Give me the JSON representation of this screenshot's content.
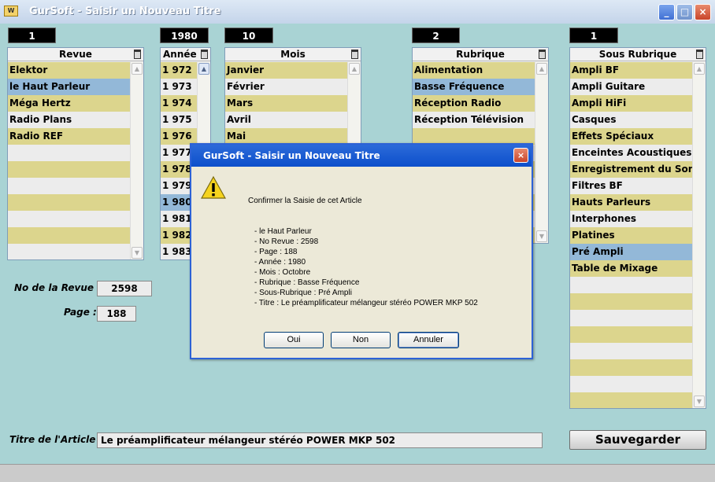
{
  "window": {
    "logo_text": "W",
    "title": "GurSoft   -   Saisir un Nouveau Titre"
  },
  "counters": {
    "revue": "1",
    "annee": "1980",
    "mois": "10",
    "rubrique": "2",
    "sous_rubrique": "1"
  },
  "lists": {
    "revue": {
      "header": "Revue",
      "items": [
        "Elektor",
        "le Haut Parleur",
        "Méga Hertz",
        "Radio Plans",
        "Radio REF"
      ],
      "selected": 1,
      "rows": 12
    },
    "annee": {
      "header": "Année",
      "items": [
        "1 972",
        "1 973",
        "1 974",
        "1 975",
        "1 976",
        "1 977",
        "1 978",
        "1 979",
        "1 980",
        "1 981",
        "1 982",
        "1 983"
      ],
      "selected": 8,
      "rows": 12
    },
    "mois": {
      "header": "Mois",
      "items": [
        "Janvier",
        "Février",
        "Mars",
        "Avril",
        "Mai"
      ],
      "selected": -1,
      "rows": 12
    },
    "rubrique": {
      "header": "Rubrique",
      "items": [
        "Alimentation",
        "Basse Fréquence",
        "Réception Radio",
        "Réception Télévision"
      ],
      "selected": 1,
      "rows": 12
    },
    "sous_rubrique": {
      "header": "Sous Rubrique",
      "items": [
        "Ampli BF",
        "Ampli Guitare",
        "Ampli HiFi",
        "Casques",
        "Effets Spéciaux",
        "Enceintes Acoustiques",
        "Enregistrement du Son",
        "Filtres BF",
        "Hauts Parleurs",
        "Interphones",
        "Platines",
        "Pré Ampli",
        "Table de Mixage"
      ],
      "selected": 11,
      "rows": 21
    }
  },
  "fields": {
    "no_revue_label": "No de la Revue :",
    "no_revue_value": "2598",
    "page_label": "Page :",
    "page_value": "188",
    "titre_label": "Titre de l'Article :",
    "titre_value": "Le préamplificateur mélangeur stéréo POWER MKP 502"
  },
  "save_button": "Sauvegarder",
  "dialog": {
    "title": "GurSoft   -   Saisir un Nouveau Titre",
    "close_label": "×",
    "message": "Confirmer la Saisie de cet Article",
    "details": [
      "- le Haut Parleur",
      "- No Revue : 2598",
      "- Page : 188",
      "- Année : 1980",
      "- Mois : Octobre",
      "- Rubrique : Basse Fréquence",
      "- Sous-Rubrique : Pré Ampli",
      "- Titre : Le préamplificateur mélangeur stéréo POWER MKP 502"
    ],
    "buttons": {
      "yes": "Oui",
      "no": "Non",
      "cancel": "Annuler"
    }
  },
  "colors": {
    "client_bg": "#a9d3d4",
    "row_odd": "#dcd58d",
    "row_selected": "#93b8d8",
    "dialog_title": "#0c4fcb"
  }
}
